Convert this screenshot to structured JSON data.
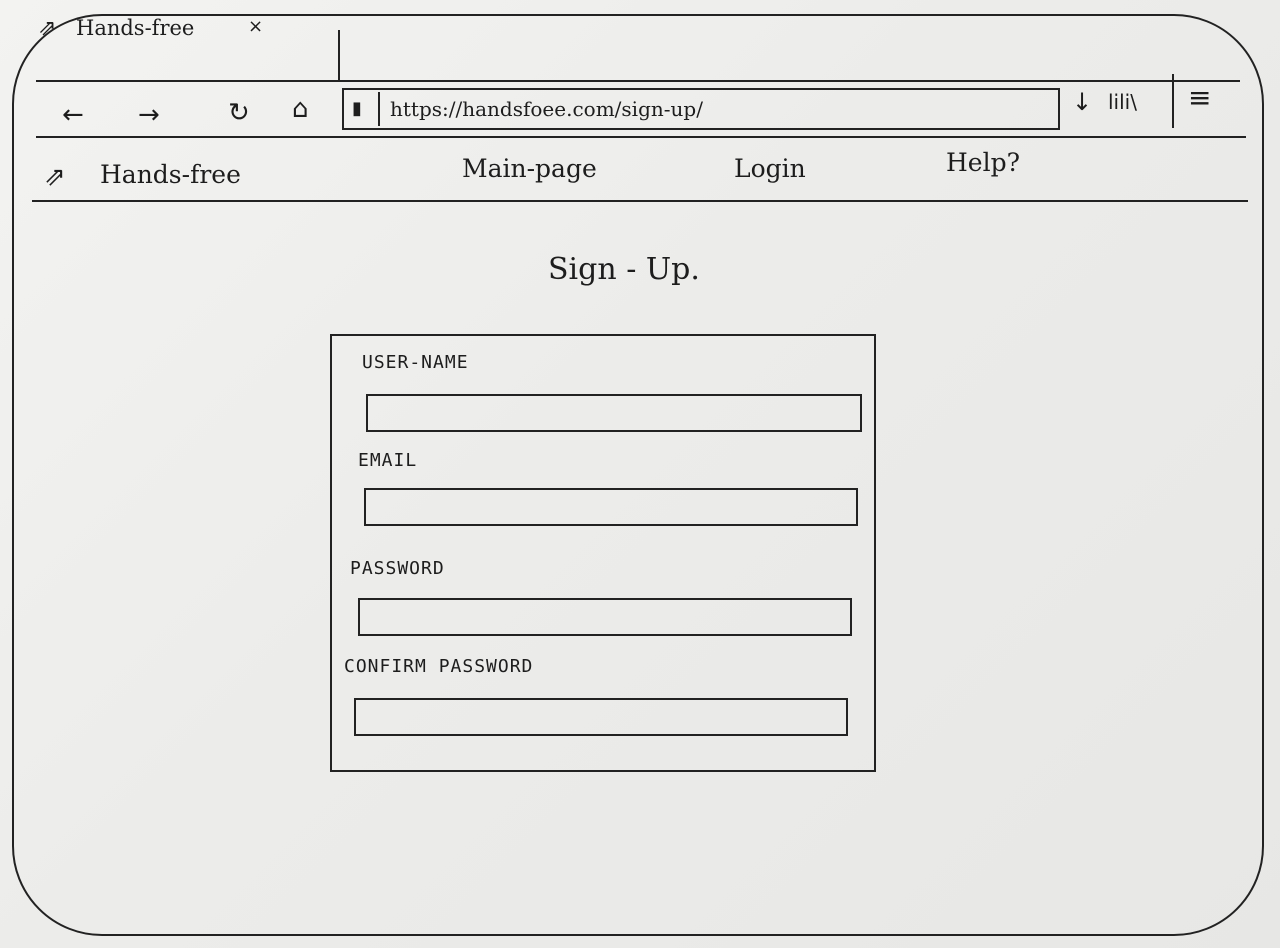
{
  "browser": {
    "tab": {
      "icon": "arrow-up-right-icon",
      "title": "Hands-free",
      "close": "×"
    },
    "toolbar": {
      "back": "←",
      "forward": "→",
      "reload": "↻",
      "home": "⌂",
      "address": "https://handsfoee.com/sign-up/",
      "shield": "▮",
      "download": "↓",
      "library": "lili\\",
      "menu": "≡"
    }
  },
  "site": {
    "logo": "Hands-free",
    "logo_icon": "arrow-up-right-icon",
    "nav": {
      "main": "Main-page",
      "login": "Login",
      "help": "Help?"
    }
  },
  "form": {
    "title": "Sign - Up.",
    "fields": {
      "username": "USER-NAME",
      "email": "EMAIL",
      "password": "PASSWORD",
      "confirm": "CONFIRM PASSWORD"
    }
  }
}
